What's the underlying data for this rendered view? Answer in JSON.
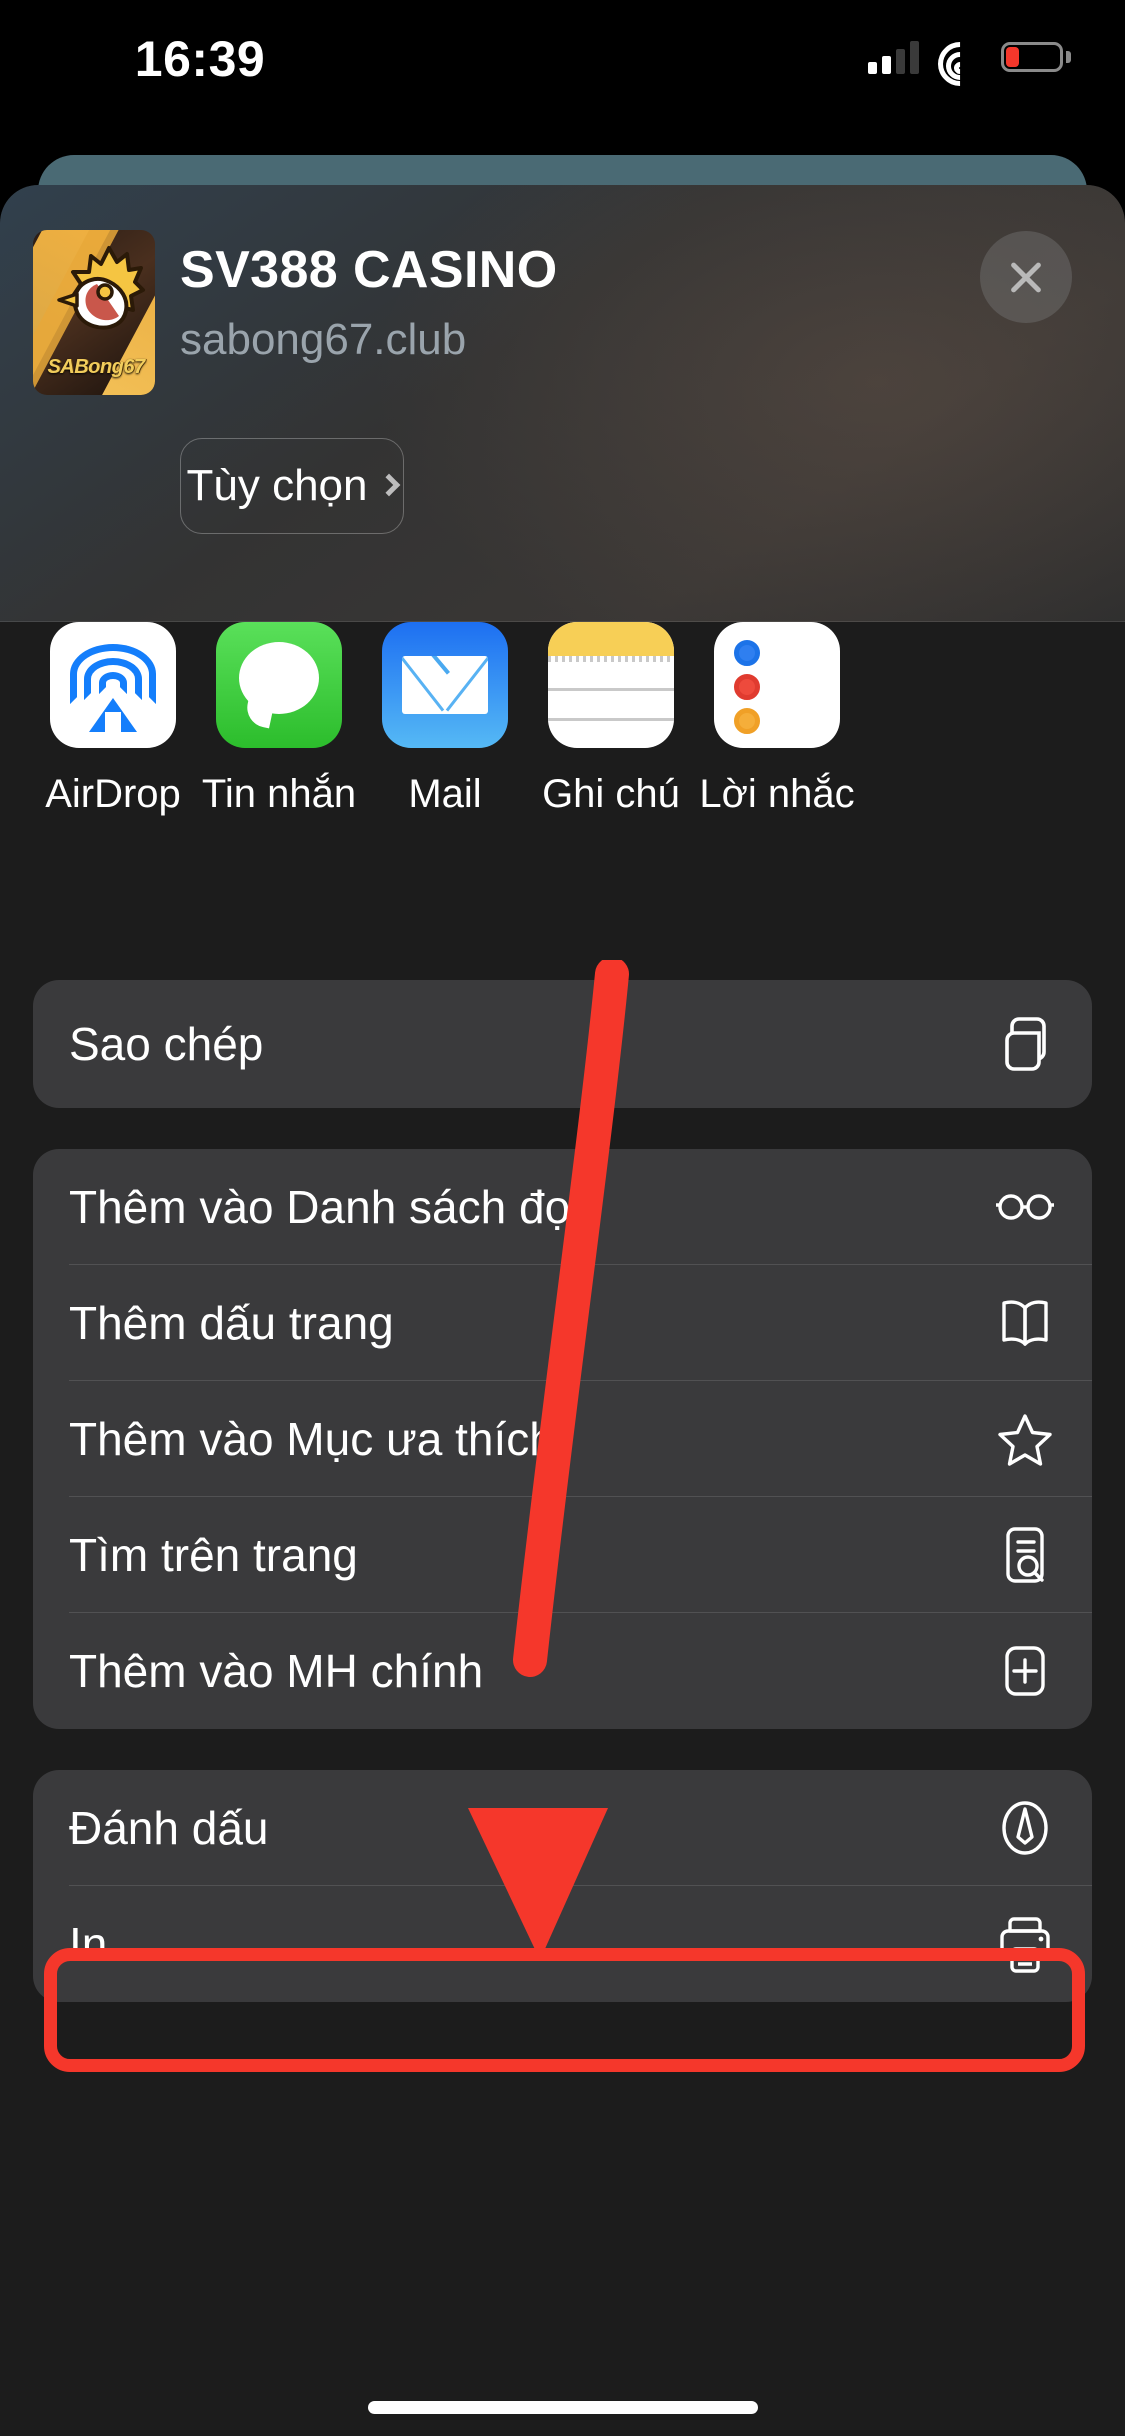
{
  "status_bar": {
    "time": "16:39",
    "cellular_icon": "cellular-signal-icon",
    "wifi_icon": "wifi-icon",
    "battery_icon": "battery-low-icon",
    "battery_level_percent": 15
  },
  "share_sheet": {
    "app_title": "SV388 CASINO",
    "app_url": "sabong67.club",
    "app_thumb_brand": "SABong67",
    "close_label": "×",
    "options_label": "Tùy chọn",
    "options_chevron": "chevron-right-icon",
    "apps": [
      {
        "label": "AirDrop",
        "icon": "airdrop-icon"
      },
      {
        "label": "Tin nhắn",
        "icon": "messages-icon"
      },
      {
        "label": "Mail",
        "icon": "mail-icon"
      },
      {
        "label": "Ghi chú",
        "icon": "notes-icon"
      },
      {
        "label": "Lời nhắc",
        "icon": "reminders-icon"
      }
    ],
    "group1": [
      {
        "label": "Sao chép",
        "icon": "copy-icon"
      }
    ],
    "group2": [
      {
        "label": "Thêm vào Danh sách đọc",
        "icon": "glasses-icon"
      },
      {
        "label": "Thêm dấu trang",
        "icon": "book-icon"
      },
      {
        "label": "Thêm vào Mục ưa thích",
        "icon": "star-icon"
      },
      {
        "label": "Tìm trên trang",
        "icon": "find-on-page-icon"
      },
      {
        "label": "Thêm vào MH chính",
        "icon": "add-to-home-screen-icon"
      }
    ],
    "group3": [
      {
        "label": "Đánh dấu",
        "icon": "markup-pen-icon"
      },
      {
        "label": "In",
        "icon": "printer-icon"
      }
    ]
  },
  "annotation": {
    "arrow_color": "#f5372b",
    "highlight_color": "#f5372b",
    "highlighted_item": "Thêm vào MH chính"
  },
  "colors": {
    "sheet_background": "#1c1c1c",
    "row_background": "#3a3a3c",
    "behind_card": "#4a6a74",
    "url_text": "#9aa4ac",
    "battery_red": "#f5372b"
  }
}
